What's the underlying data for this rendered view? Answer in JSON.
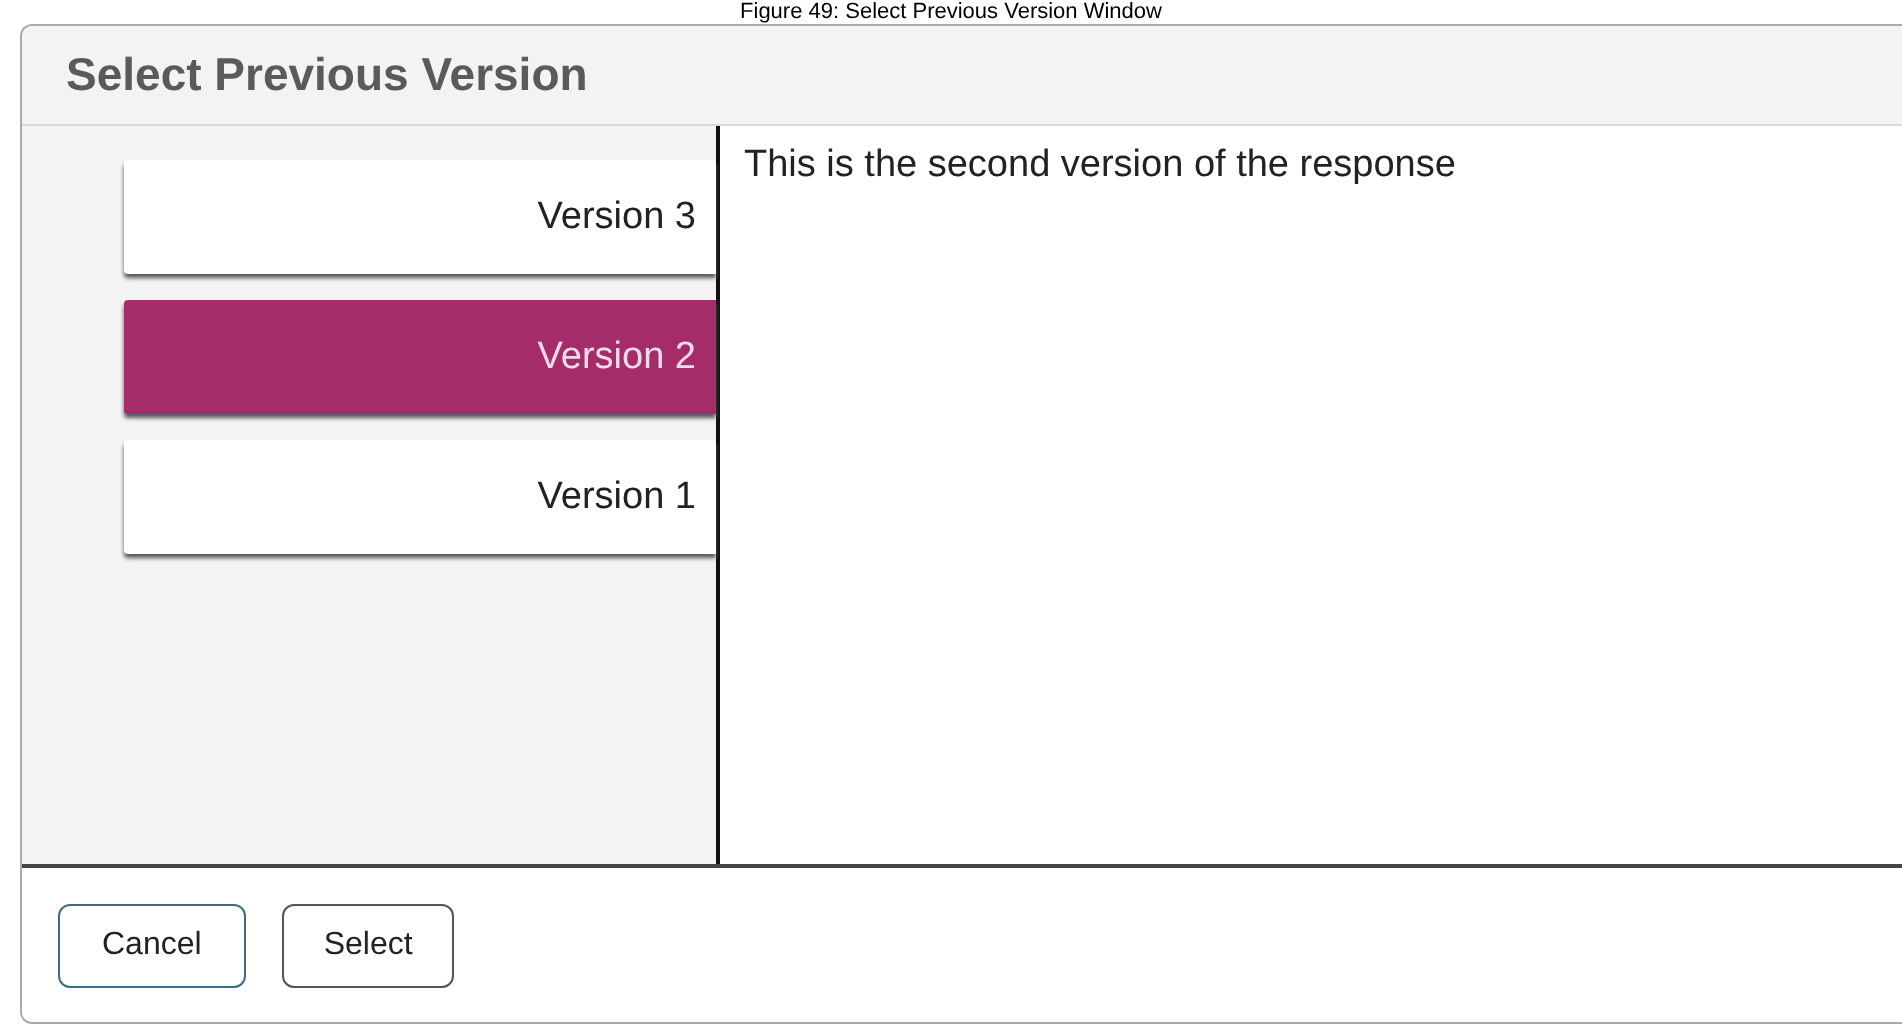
{
  "caption": "Figure 49: Select Previous Version Window",
  "dialog": {
    "title": "Select Previous Version",
    "versions": [
      {
        "label": "Version 3",
        "selected": false
      },
      {
        "label": "Version 2",
        "selected": true
      },
      {
        "label": "Version 1",
        "selected": false
      }
    ],
    "preview_text": "This is the second version of the response",
    "buttons": [
      "Cancel",
      "Select"
    ]
  }
}
